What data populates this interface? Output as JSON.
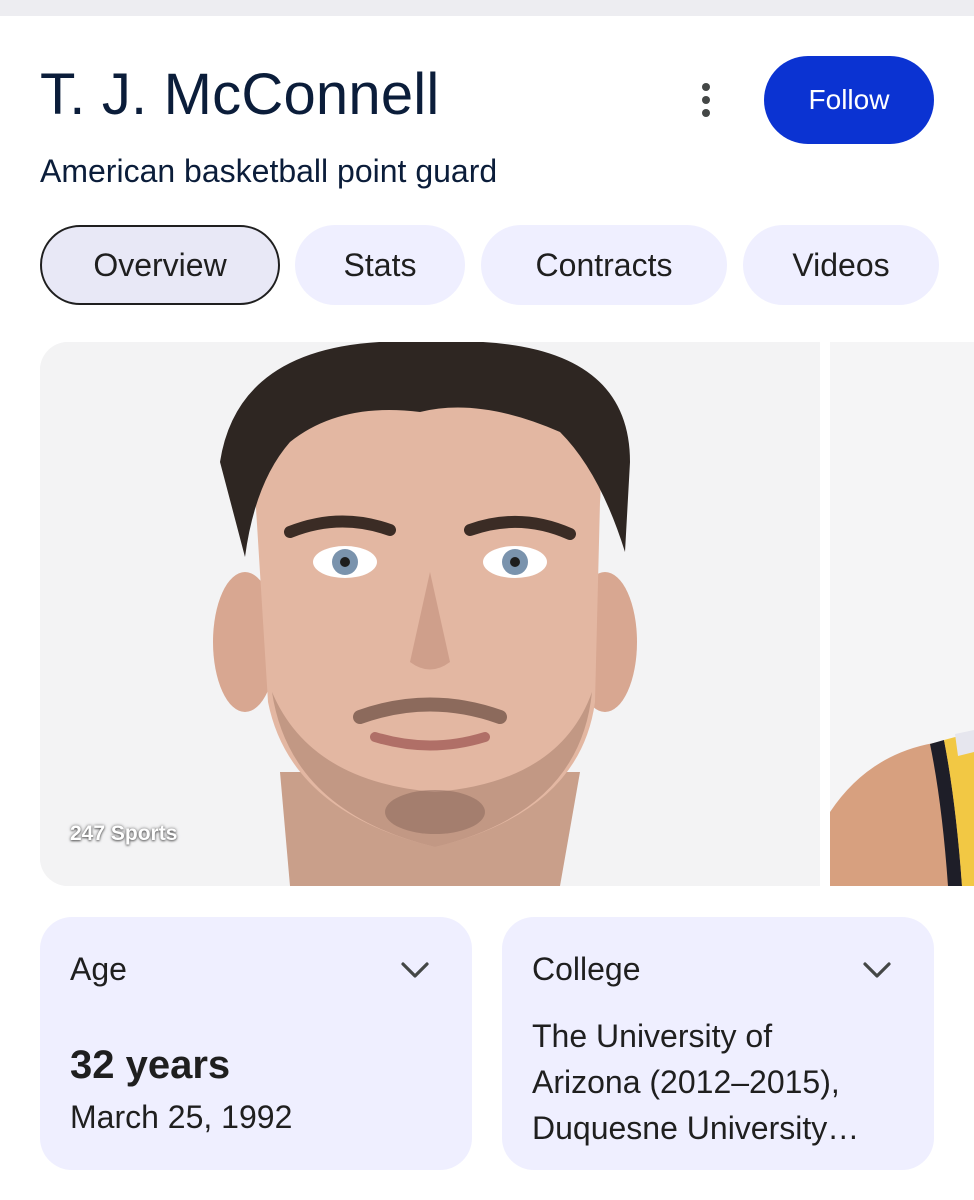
{
  "header": {
    "title": "T. J. McConnell",
    "subtitle": "American basketball point guard",
    "more_icon": "more-vert-icon",
    "follow_label": "Follow",
    "accent": "#0b33d2"
  },
  "tabs": [
    {
      "label": "Overview",
      "active": true
    },
    {
      "label": "Stats",
      "active": false
    },
    {
      "label": "Contracts",
      "active": false
    },
    {
      "label": "Videos",
      "active": false
    }
  ],
  "images": {
    "source_label": "247 Sports"
  },
  "facts": {
    "age": {
      "label": "Age",
      "value": "32 years",
      "detail": "March 25, 1992",
      "icon": "chevron-down-icon"
    },
    "college": {
      "label": "College",
      "value": "The University of\nArizona (2012–2015),\nDuquesne University…",
      "icon": "chevron-down-icon"
    }
  }
}
